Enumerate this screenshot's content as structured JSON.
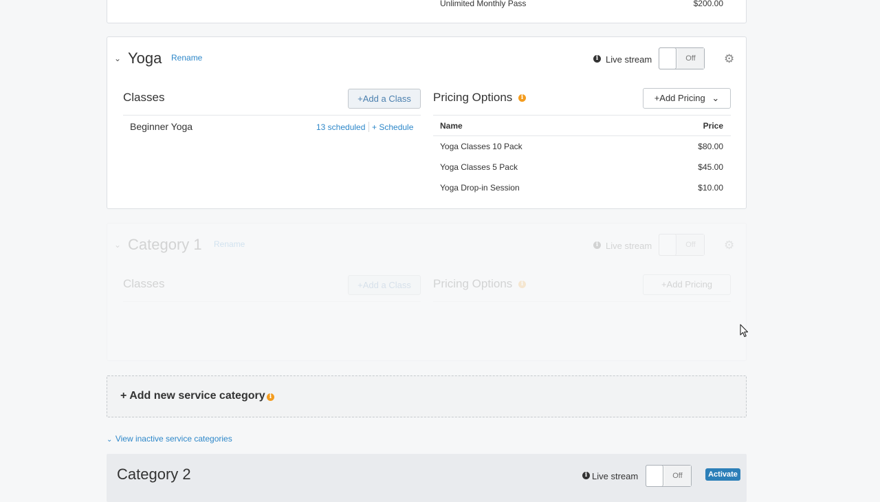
{
  "top_card": {
    "row_name": "Unlimited Monthly Pass",
    "row_price": "$200.00"
  },
  "yoga": {
    "title": "Yoga",
    "rename": "Rename",
    "live_stream": "Live stream",
    "toggle": "Off",
    "classes_title": "Classes",
    "add_class": "Add a Class",
    "classes": [
      {
        "name": "Beginner Yoga",
        "scheduled": "13 scheduled",
        "schedule": "Schedule"
      }
    ],
    "pricing_title": "Pricing Options",
    "add_pricing": "Add Pricing",
    "pricing_headers": {
      "name": "Name",
      "price": "Price"
    },
    "pricing": [
      {
        "name": "Yoga Classes 10 Pack",
        "price": "$80.00"
      },
      {
        "name": "Yoga Classes 5 Pack",
        "price": "$45.00"
      },
      {
        "name": "Yoga Drop-in Session",
        "price": "$10.00"
      }
    ]
  },
  "category1": {
    "title": "Category 1",
    "rename": "Rename",
    "live_stream": "Live stream",
    "toggle": "Off",
    "classes_title": "Classes",
    "add_class": "Add a Class",
    "pricing_title": "Pricing Options",
    "add_pricing": "Add Pricing"
  },
  "add_category": {
    "label": "Add new service category"
  },
  "inactive_link": "View inactive service categories",
  "category2": {
    "title": "Category 2",
    "live_stream": "Live stream",
    "toggle": "Off",
    "activate": "Activate"
  }
}
